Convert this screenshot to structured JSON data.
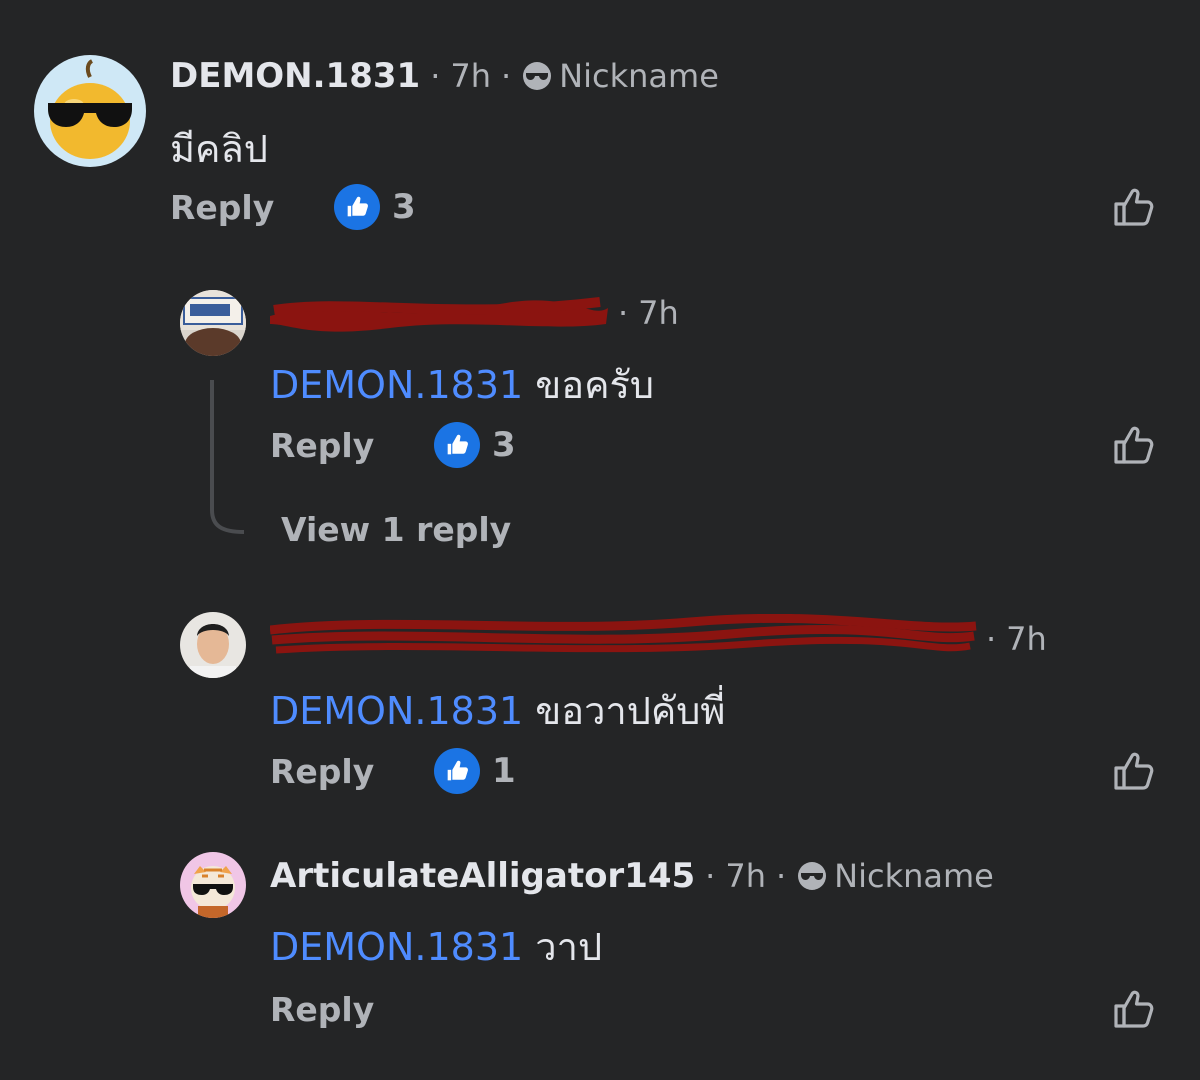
{
  "comments": [
    {
      "author": "DEMON.1831",
      "time": "7h",
      "nickname": "Nickname",
      "text": "มีคลิป",
      "reply": "Reply",
      "likes": "3"
    },
    {
      "author": "",
      "time": "7h",
      "mention": "DEMON.1831",
      "text": "ขอครับ",
      "reply": "Reply",
      "likes": "3",
      "view_replies": "View 1 reply"
    },
    {
      "author": "",
      "time": "7h",
      "mention": "DEMON.1831",
      "text": "ขอวาปคับพี่",
      "reply": "Reply",
      "likes": "1"
    },
    {
      "author": "ArticulateAlligator145",
      "time": "7h",
      "nickname": "Nickname",
      "mention": "DEMON.1831",
      "text": "วาป",
      "reply": "Reply"
    }
  ],
  "colors": {
    "background": "#242526",
    "mention": "#4f8cff",
    "like_badge": "#1b74e4",
    "redaction": "#8b1410"
  },
  "icons": [
    "pear-sunglasses-avatar",
    "sunglasses-icon",
    "like-badge-icon",
    "thumbs-up-outline-icon",
    "tiger-sunglasses-avatar"
  ]
}
